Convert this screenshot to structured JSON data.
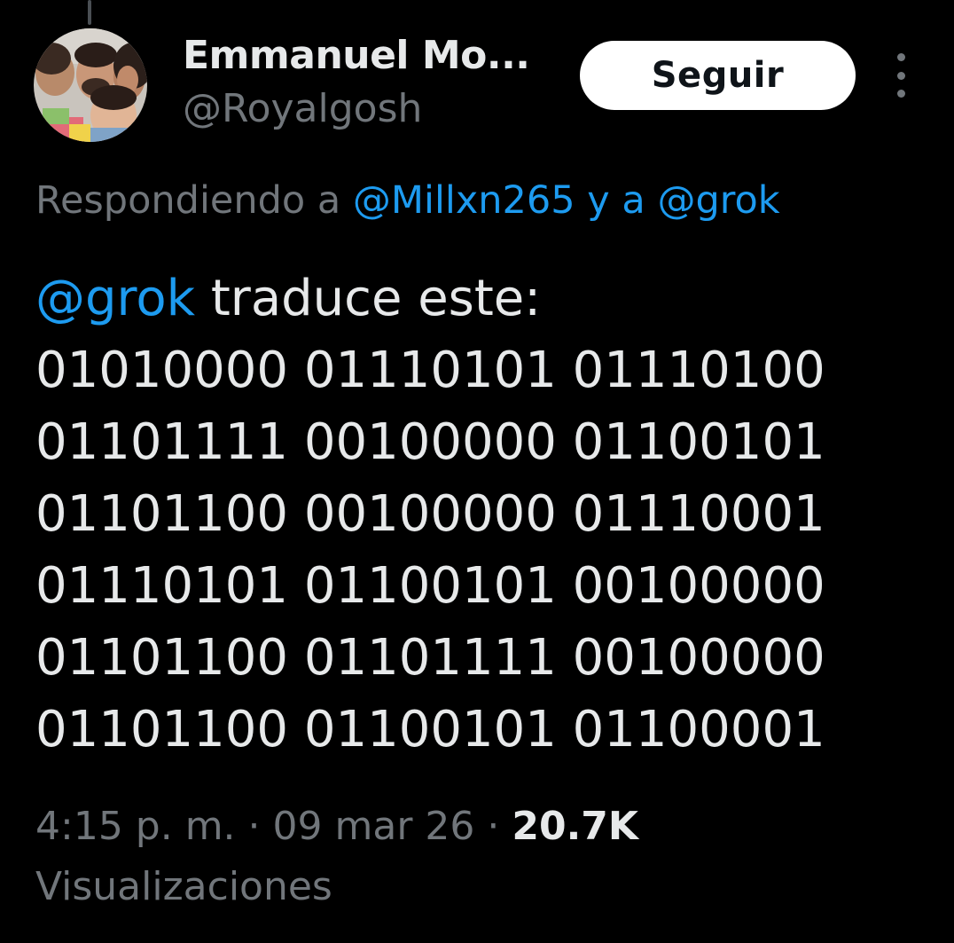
{
  "author": {
    "display_name": "Emmanuel Mo...",
    "handle": "@Royalgosh",
    "avatar_icon": "family-photo-avatar"
  },
  "follow_button": {
    "label": "Seguir"
  },
  "more_menu": {
    "icon": "vertical-ellipsis-icon"
  },
  "replying_to": {
    "prefix": "Respondiendo a ",
    "first_mention": "@Millxn265",
    "conjunction": " y a ",
    "second_mention": "@grok"
  },
  "tweet": {
    "mention": "@grok",
    "intro_text": " traduce este:",
    "binary_lines": [
      "01010000 01110101 01110100",
      "01101111 00100000 01100101",
      "01101100 00100000 01110001",
      "01110101 01100101 00100000",
      "01101100 01101111 00100000",
      "01101100 01100101 01100001"
    ]
  },
  "meta": {
    "time": "4:15 p. m.",
    "separator": " · ",
    "date": "09 mar 26",
    "views_count": "20.7K",
    "views_label": "Visualizaciones"
  },
  "colors": {
    "background": "#000000",
    "primary_text": "#e7e9ea",
    "secondary_text": "#71767b",
    "link": "#1d9bf0",
    "button_bg": "#ffffff",
    "button_text": "#0f1419"
  }
}
